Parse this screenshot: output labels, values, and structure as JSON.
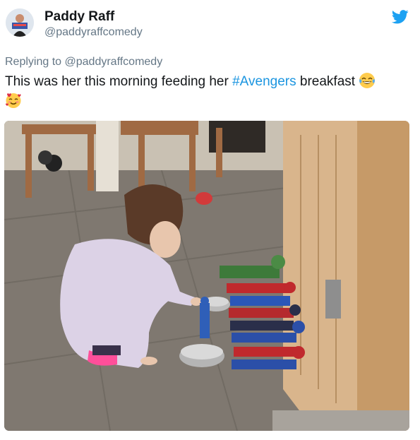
{
  "tweet": {
    "display_name": "Paddy Raff",
    "handle": "@paddyraffcomedy",
    "reply_prefix": "Replying to",
    "reply_to": "@paddyraffcomedy",
    "text_before": "This was her this morning feeding her ",
    "hashtag": "#Avengers",
    "text_after": " breakfast",
    "emojis": [
      "face-with-tears-of-joy",
      "smiling-face-with-hearts"
    ],
    "avatar_icon": "profile-avatar",
    "brand_icon": "twitter-bird-icon"
  },
  "photo": {
    "icon": "tweet-photo",
    "subject": "toddler-feeding-avengers-figures"
  },
  "colors": {
    "brand": "#1da1f2",
    "hashtag": "#1b95e0",
    "secondary_text": "#657786",
    "primary_text": "#14171a"
  }
}
